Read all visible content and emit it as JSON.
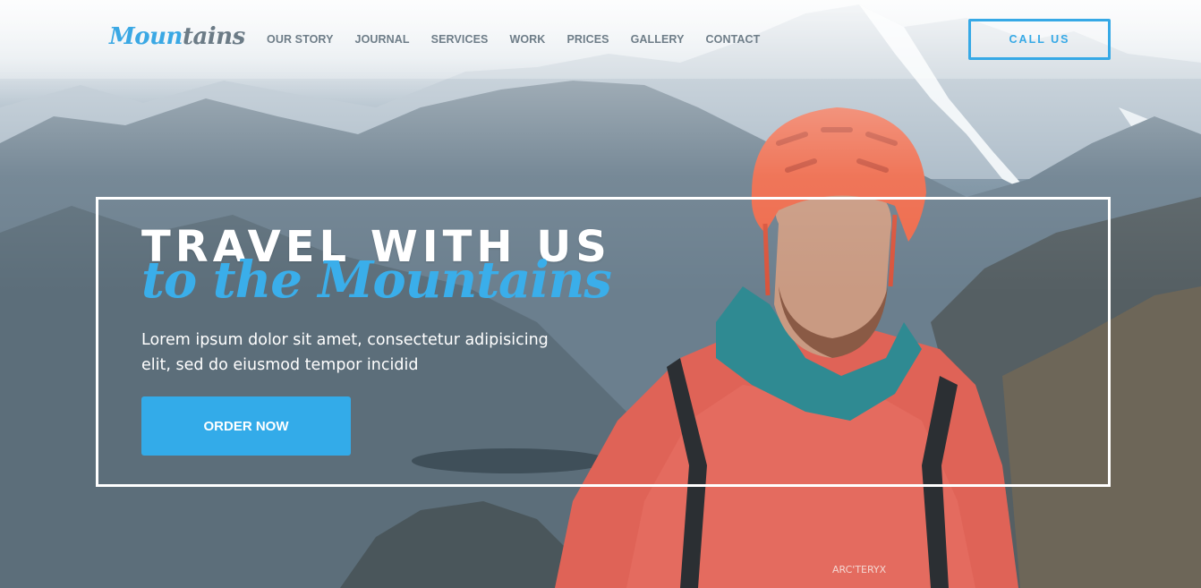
{
  "brand": {
    "logo_main": "Moun",
    "logo_tail": "tains"
  },
  "nav": {
    "items": [
      {
        "label": "OUR STORY"
      },
      {
        "label": "JOURNAL"
      },
      {
        "label": "SERVICES"
      },
      {
        "label": "WORK"
      },
      {
        "label": "PRICES"
      },
      {
        "label": "GALLERY"
      },
      {
        "label": "CONTACT"
      }
    ],
    "cta_label": "CALL US"
  },
  "hero": {
    "headline": "TRAVEL WITH US",
    "subheadline": "to the Mountains",
    "lead": "Lorem ipsum dolor sit amet, consectetur adipisicing elit, sed do eiusmod tempor incidid",
    "button_label": "ORDER NOW",
    "background_image": "climber-in-red-helmet-and-jacket-mountains-photo"
  },
  "colors": {
    "accent": "#36a9e6",
    "nav_text": "#6e7d88",
    "white": "#ffffff"
  }
}
